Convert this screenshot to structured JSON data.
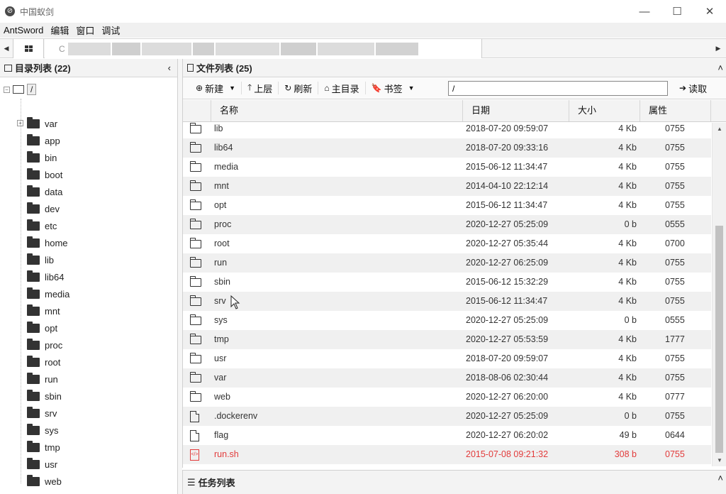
{
  "window": {
    "title": "中国蚁剑",
    "icon_name": "antsword-logo-icon",
    "minimize": "—",
    "maximize": "☐",
    "close": "✕"
  },
  "menu": [
    "AntSword",
    "编辑",
    "窗口",
    "调试"
  ],
  "tabs": {
    "left_arrow": "◀",
    "right_arrow": "▶",
    "site_tab_label": "C"
  },
  "left_panel": {
    "title": "目录列表 (22)",
    "collapse": "‹",
    "root_label": "/",
    "items": [
      "var",
      "app",
      "bin",
      "boot",
      "data",
      "dev",
      "etc",
      "home",
      "lib",
      "lib64",
      "media",
      "mnt",
      "opt",
      "proc",
      "root",
      "run",
      "sbin",
      "srv",
      "sys",
      "tmp",
      "usr",
      "web"
    ]
  },
  "right_panel": {
    "title": "文件列表 (25)",
    "collapse": "˄",
    "toolbar": {
      "new_label": "新建",
      "up_label": "上层",
      "refresh_label": "刷新",
      "home_label": "主目录",
      "bookmark_label": "书签",
      "path_value": "/",
      "read_label": "读取"
    },
    "columns": {
      "name": "名称",
      "date": "日期",
      "size": "大小",
      "perm": "属性"
    },
    "files": [
      {
        "type": "folder",
        "name": "lib",
        "date": "2018-07-20 09:59:07",
        "size": "4 Kb",
        "perm": "0755"
      },
      {
        "type": "folder",
        "name": "lib64",
        "date": "2018-07-20 09:33:16",
        "size": "4 Kb",
        "perm": "0755"
      },
      {
        "type": "folder",
        "name": "media",
        "date": "2015-06-12 11:34:47",
        "size": "4 Kb",
        "perm": "0755"
      },
      {
        "type": "folder",
        "name": "mnt",
        "date": "2014-04-10 22:12:14",
        "size": "4 Kb",
        "perm": "0755"
      },
      {
        "type": "folder",
        "name": "opt",
        "date": "2015-06-12 11:34:47",
        "size": "4 Kb",
        "perm": "0755"
      },
      {
        "type": "folder",
        "name": "proc",
        "date": "2020-12-27 05:25:09",
        "size": "0 b",
        "perm": "0555"
      },
      {
        "type": "folder",
        "name": "root",
        "date": "2020-12-27 05:35:44",
        "size": "4 Kb",
        "perm": "0700"
      },
      {
        "type": "folder",
        "name": "run",
        "date": "2020-12-27 06:25:09",
        "size": "4 Kb",
        "perm": "0755"
      },
      {
        "type": "folder",
        "name": "sbin",
        "date": "2015-06-12 15:32:29",
        "size": "4 Kb",
        "perm": "0755"
      },
      {
        "type": "folder",
        "name": "srv",
        "date": "2015-06-12 11:34:47",
        "size": "4 Kb",
        "perm": "0755"
      },
      {
        "type": "folder",
        "name": "sys",
        "date": "2020-12-27 05:25:09",
        "size": "0 b",
        "perm": "0555"
      },
      {
        "type": "folder",
        "name": "tmp",
        "date": "2020-12-27 05:53:59",
        "size": "4 Kb",
        "perm": "1777"
      },
      {
        "type": "folder",
        "name": "usr",
        "date": "2018-07-20 09:59:07",
        "size": "4 Kb",
        "perm": "0755"
      },
      {
        "type": "folder",
        "name": "var",
        "date": "2018-08-06 02:30:44",
        "size": "4 Kb",
        "perm": "0755"
      },
      {
        "type": "folder",
        "name": "web",
        "date": "2020-12-27 06:20:00",
        "size": "4 Kb",
        "perm": "0777"
      },
      {
        "type": "file",
        "name": ".dockerenv",
        "date": "2020-12-27 05:25:09",
        "size": "0 b",
        "perm": "0755"
      },
      {
        "type": "file",
        "name": "flag",
        "date": "2020-12-27 06:20:02",
        "size": "49 b",
        "perm": "0644"
      },
      {
        "type": "script",
        "name": "run.sh",
        "date": "2015-07-08 09:21:32",
        "size": "308 b",
        "perm": "0755"
      }
    ],
    "highlight_color": "#e23b3b"
  },
  "task_panel": {
    "title": "任务列表",
    "collapse": "˄"
  }
}
